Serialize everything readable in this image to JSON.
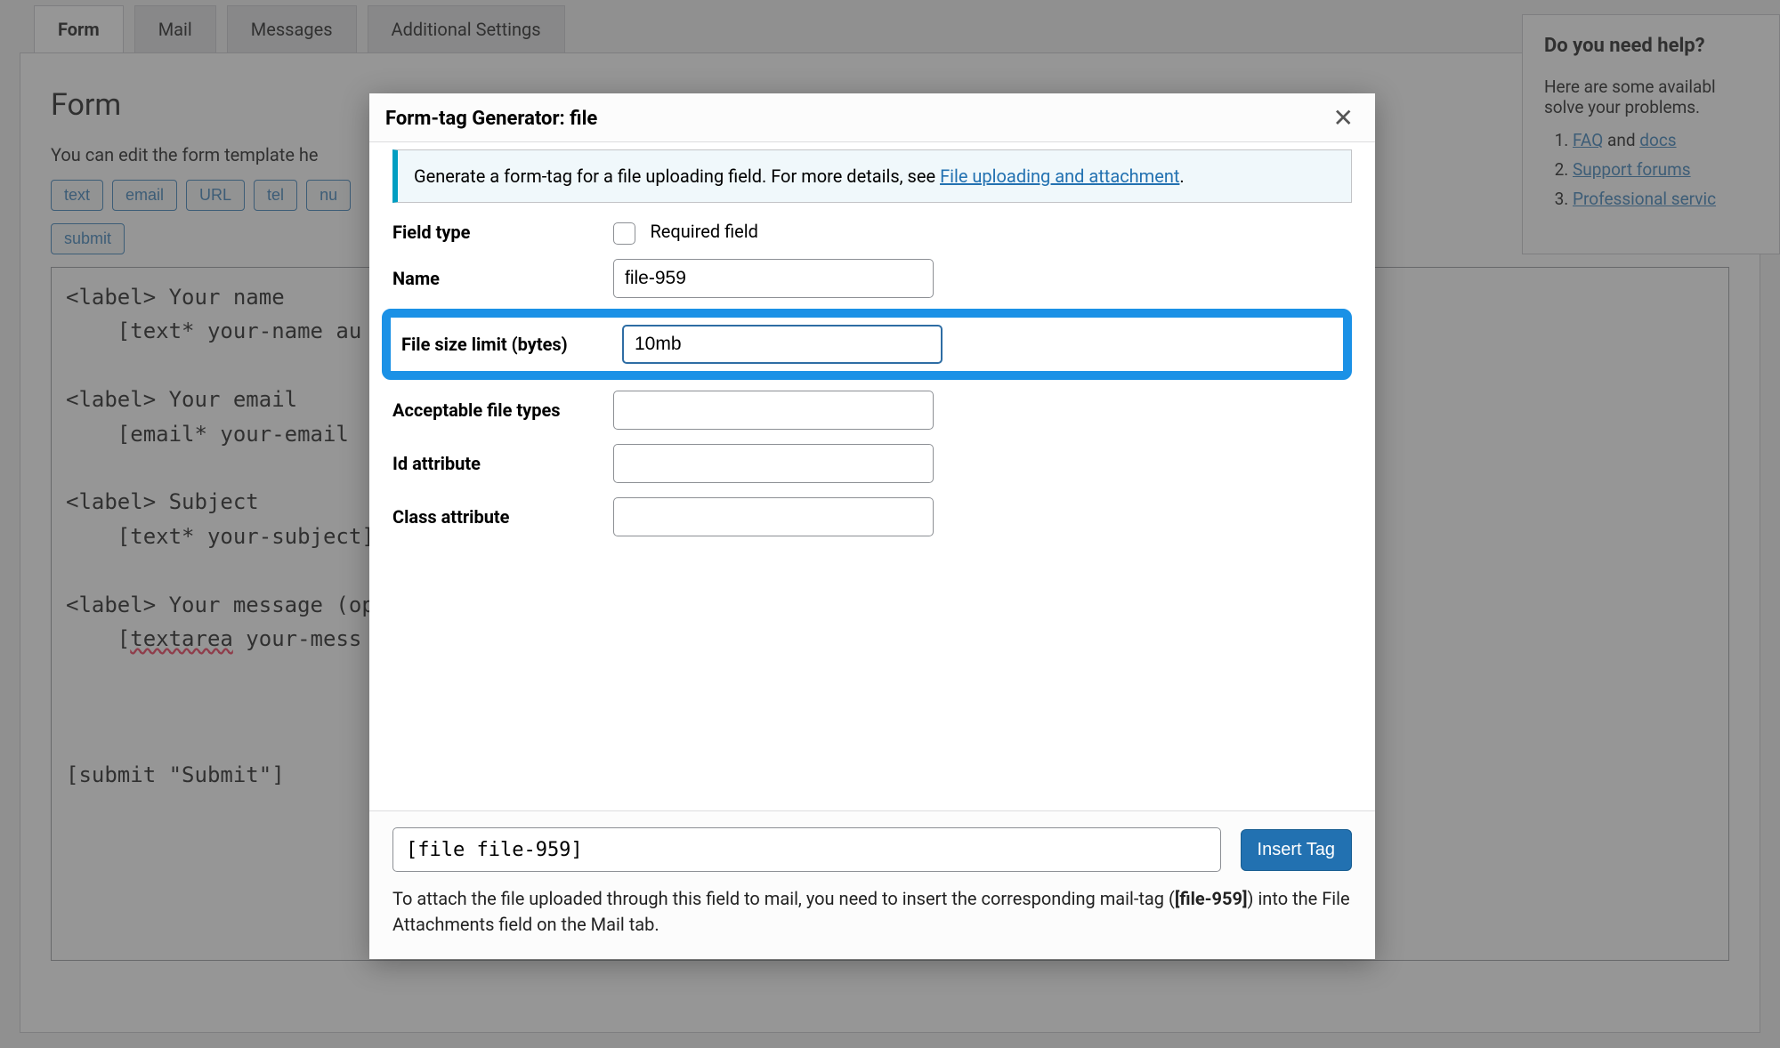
{
  "tabs": {
    "form": "Form",
    "mail": "Mail",
    "messages": "Messages",
    "additional": "Additional Settings"
  },
  "panel": {
    "heading": "Form",
    "helper": "You can edit the form template he",
    "tag_buttons": [
      "text",
      "email",
      "URL",
      "tel",
      "nu"
    ],
    "submit_btn": "submit",
    "code_l1": "<label> Your name",
    "code_l2": "    [text* your-name au",
    "code_l3": "",
    "code_l4": "<label> Your email",
    "code_l5": "    [email* your-email ",
    "code_l6": "",
    "code_l7": "<label> Subject",
    "code_l8": "    [text* your-subject]",
    "code_l9": "",
    "code_l10": "<label> Your message (op",
    "code_l11a": "    [",
    "code_l11b": "textarea",
    "code_l11c": " your-mess",
    "code_l12": "",
    "code_l13": "",
    "code_l14": "",
    "code_l15": "[submit \"Submit\"]"
  },
  "sidebar": {
    "heading": "Do you need help?",
    "intro": "Here are some availabl solve your problems.",
    "faq": "FAQ",
    "and": " and ",
    "docs": "docs",
    "support": "Support forums",
    "pro": "Professional servic"
  },
  "modal": {
    "title": "Form-tag Generator: file",
    "info_pre": "Generate a form-tag for a file uploading field. For more details, see ",
    "info_link": "File uploading and attachment",
    "info_post": ".",
    "labels": {
      "field_type": "Field type",
      "required": "Required field",
      "name": "Name",
      "file_size": "File size limit (bytes)",
      "accept": "Acceptable file types",
      "id_attr": "Id attribute",
      "class_attr": "Class attribute"
    },
    "values": {
      "name": "file-959",
      "file_size": "10mb",
      "accept": "",
      "id_attr": "",
      "class_attr": ""
    },
    "tag_output": "[file file-959]",
    "insert": "Insert Tag",
    "foot_pre": "To attach the file uploaded through this field to mail, you need to insert the corresponding mail-tag (",
    "foot_tag": "[file-959]",
    "foot_post": ") into the File Attachments field on the Mail tab."
  }
}
